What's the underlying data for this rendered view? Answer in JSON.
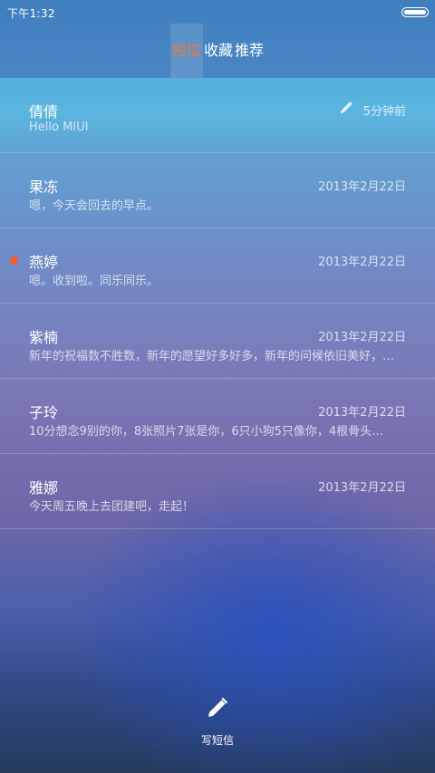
{
  "status_bar": {
    "time": "下午1:32"
  },
  "tabs": [
    {
      "label": "短信",
      "active": true
    },
    {
      "label": "收藏",
      "active": false
    },
    {
      "label": "推荐",
      "active": false
    }
  ],
  "messages": [
    {
      "name": "倩倩",
      "preview": "Hello MIUI",
      "time": "5分钟前",
      "draft": true,
      "unread": false
    },
    {
      "name": "果冻",
      "preview": "嗯，今天会回去的早点。",
      "time": "2013年2月22日",
      "draft": false,
      "unread": false
    },
    {
      "name": "燕婷",
      "preview": "嗯。收到啦。同乐同乐。",
      "time": "2013年2月22日",
      "draft": false,
      "unread": true
    },
    {
      "name": "紫楠",
      "preview": "新年的祝福数不胜数，新年的愿望好多好多，新年的问候依旧美好，新年的…",
      "time": "2013年2月22日",
      "draft": false,
      "unread": false
    },
    {
      "name": "子玲",
      "preview": "10分想念9别的你，8张照片7张是你，6只小狗5只像你，4根骨头…",
      "time": "2013年2月22日",
      "draft": false,
      "unread": false
    },
    {
      "name": "雅娜",
      "preview": "今天周五晚上去团建吧，走起！",
      "time": "2013年2月22日",
      "draft": false,
      "unread": false
    }
  ],
  "compose": {
    "label": "写短信",
    "icon": "pencil-icon"
  },
  "colors": {
    "accent": "#f0783c",
    "unread_dot": "#ff5a1e"
  }
}
